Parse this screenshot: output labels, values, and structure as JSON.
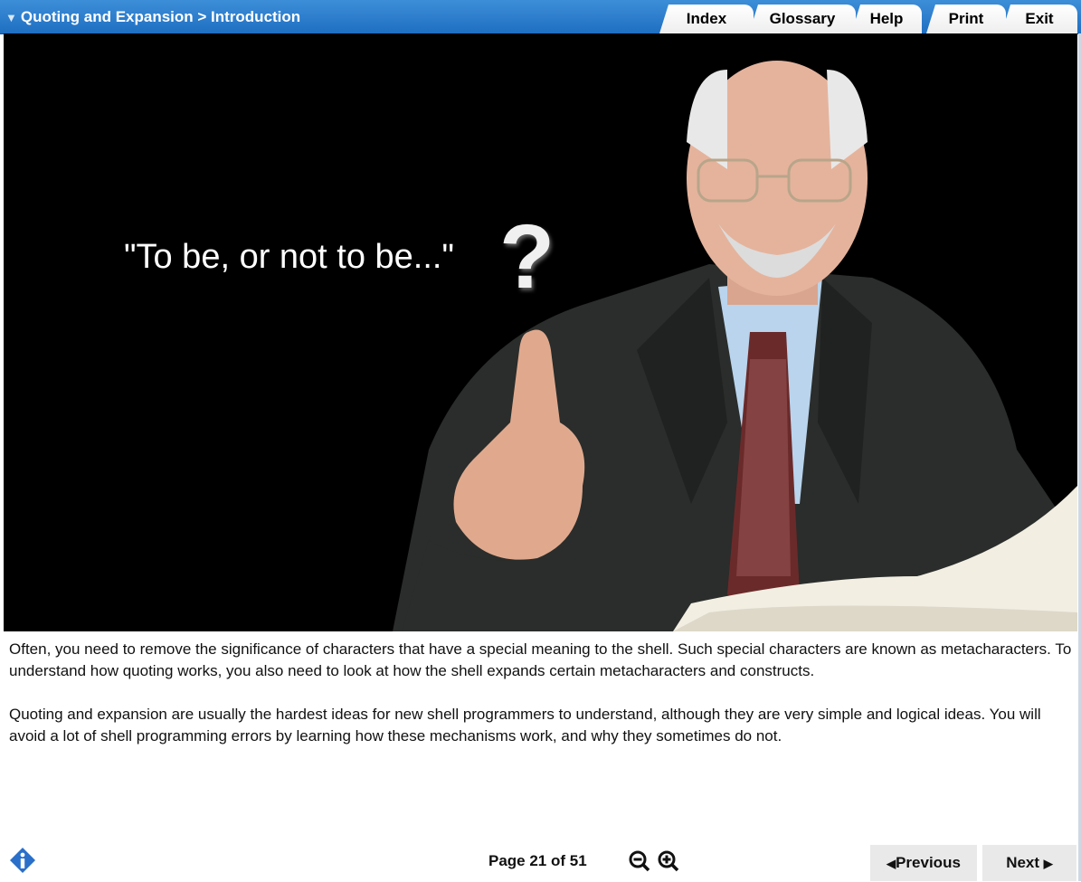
{
  "header": {
    "title": "Quoting and Expansion > Introduction",
    "tabs": [
      "Index",
      "Glossary",
      "Help",
      "Print",
      "Exit"
    ]
  },
  "stage": {
    "quote": "\"To be, or not to be...\"",
    "question_mark": "?"
  },
  "content": {
    "paragraphs": [
      "Often, you need to remove the significance of characters that have a special meaning to the shell. Such special characters are known as metacharacters. To understand how quoting works, you also need to look at how the shell expands certain metacharacters and constructs.",
      "Quoting and expansion are usually the hardest ideas for new shell programmers to understand, although they are very simple and logical ideas. You will avoid a lot of shell programming errors by learning how these mechanisms work, and why they sometimes do not."
    ]
  },
  "footer": {
    "page_label": "Page 21 of 51",
    "previous_label": "Previous",
    "next_label": "Next"
  },
  "colors": {
    "header_blue": "#1f6fc2",
    "info_blue": "#2a6fc9"
  }
}
